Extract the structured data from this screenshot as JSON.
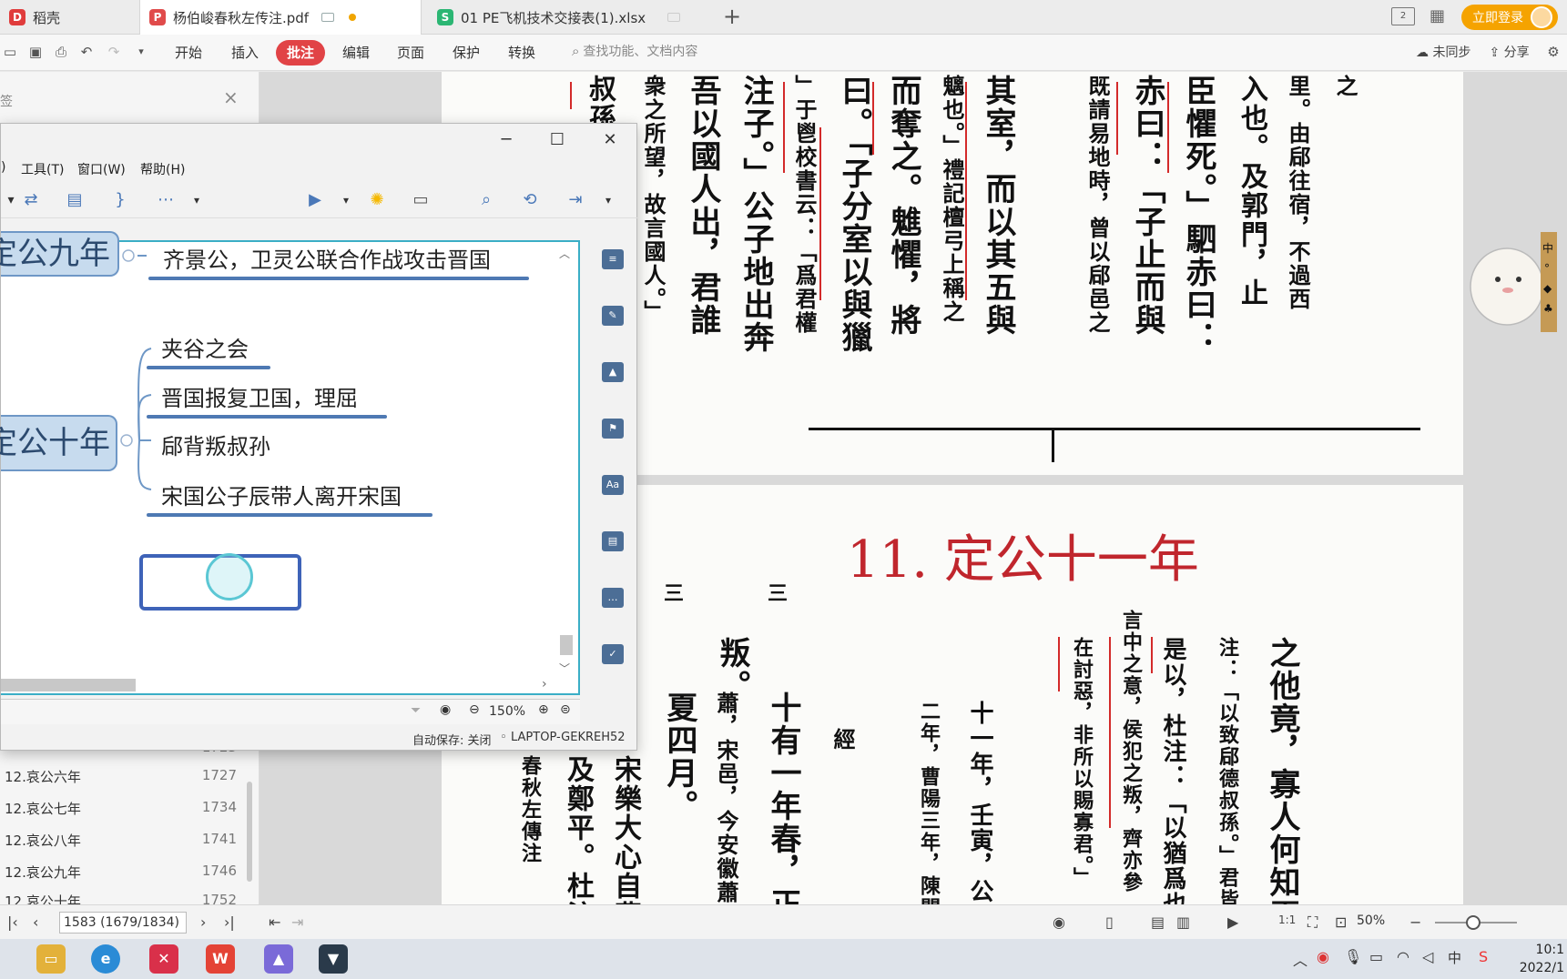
{
  "tabs": [
    {
      "label": "稻壳",
      "icon": "docer-icon",
      "color": "#e03c3c"
    },
    {
      "label": "杨伯峻春秋左传注.pdf",
      "icon": "pdf-icon",
      "color": "#e04b4b",
      "active": true
    },
    {
      "label": "01 PE飞机技术交接表(1).xlsx",
      "icon": "sheet-icon",
      "color": "#2bb673"
    }
  ],
  "top_right": {
    "login_label": "立即登录"
  },
  "toolbar": {
    "menus": [
      "开始",
      "插入",
      "批注",
      "编辑",
      "页面",
      "保护",
      "转换"
    ],
    "active_menu": "批注",
    "search_placeholder": "查找功能、文档内容",
    "sync_label": "未同步",
    "share_label": "分享"
  },
  "left_panel": {
    "bookmarks": [
      {
        "label": "12.哀公六年",
        "page": "1727"
      },
      {
        "label": "12.哀公七年",
        "page": "1734"
      },
      {
        "label": "12.哀公八年",
        "page": "1741"
      },
      {
        "label": "12.哀公九年",
        "page": "1746"
      },
      {
        "label": "12.哀公十年",
        "page": "1752"
      }
    ],
    "partial_page": "1723"
  },
  "mindmap": {
    "menus": [
      "工具(T)",
      "窗口(W)",
      "帮助(H)"
    ],
    "partial_menu": ")",
    "topics": {
      "main_9": "定公九年",
      "main_10": "定公十年",
      "sub_9_1": "齐景公，卫灵公联合作战攻击晋国",
      "sub_10_1": "夹谷之会",
      "sub_10_2": "晋国报复卫国，理屈",
      "sub_10_3": "郈背叛叔孙",
      "sub_10_4": "宋国公子辰带人离开宋国"
    },
    "zoom": "150%",
    "autosave": "自动保存: 关闭",
    "computer": "LAPTOP-GEKREH52"
  },
  "pdf": {
    "chapter_title": "11. 定公十一年",
    "page_field": "1583 (1679/1834)",
    "zoom": "50%"
  },
  "clock": {
    "time": "10:1",
    "date": "2022/1"
  },
  "colors": {
    "accent": "#e14346",
    "mindmap_border": "#3aaec6",
    "topic_underline": "#4e79b3",
    "login": "#f5a300"
  }
}
